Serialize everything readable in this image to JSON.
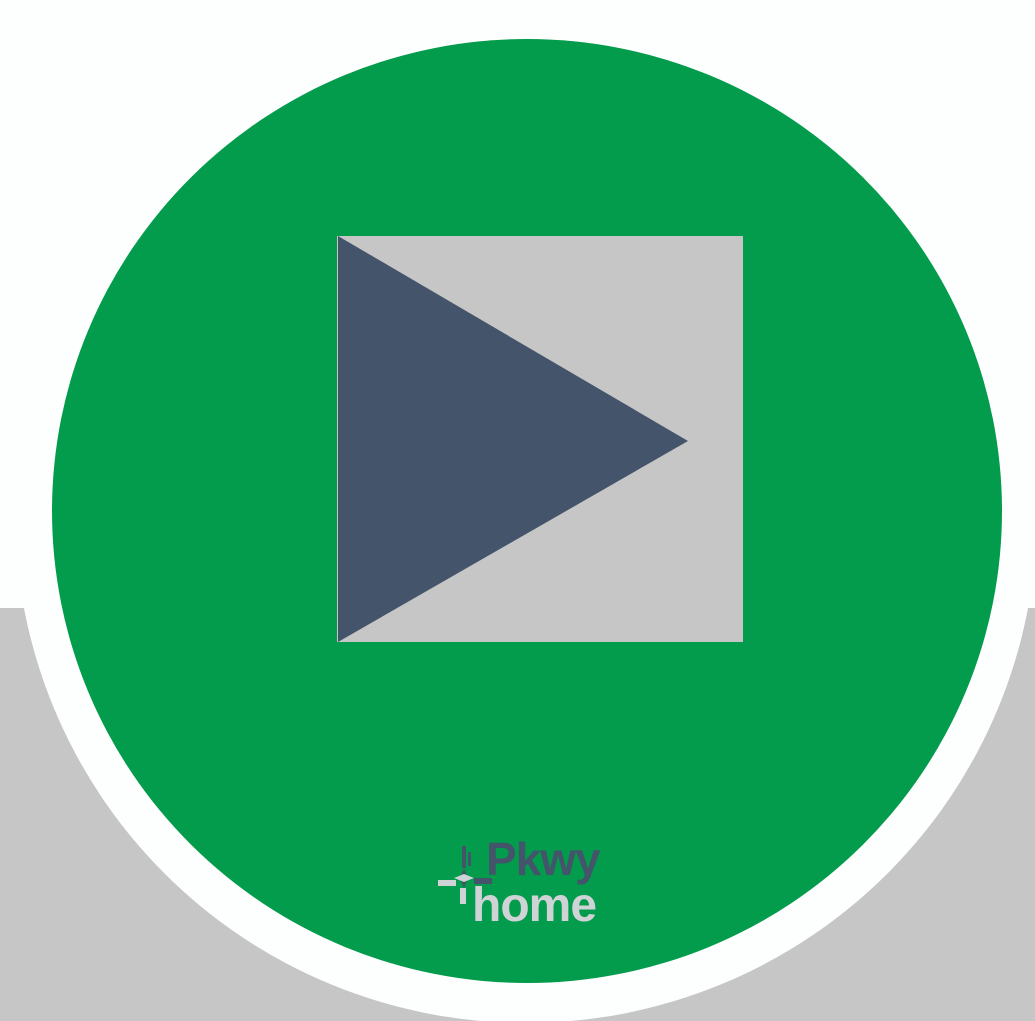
{
  "media": {
    "play_icon": "play-icon",
    "logo": {
      "line1": "Pkwy",
      "line2": "home",
      "mark_icon": "four-point-star-icon"
    }
  },
  "colors": {
    "background": "#fdfefe",
    "band": "#c6c6c6",
    "disc": "#029c4c",
    "play_square": "#c6c6c6",
    "play_triangle": "#44546a",
    "logo_primary": "#44546a",
    "logo_secondary": "#cfd3d6"
  }
}
